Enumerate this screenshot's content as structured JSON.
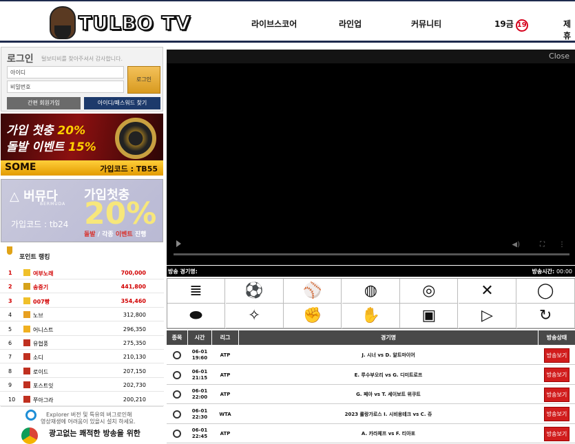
{
  "header": {
    "logo_text": "TULBO TV",
    "nav": [
      "라이브스코어",
      "라인업",
      "커뮤니티",
      "19금",
      "제휴"
    ],
    "nav_badge": "19"
  },
  "login": {
    "title": "로그인",
    "subtitle": "털보티비를 찾아주셔서 감사합니다.",
    "id_placeholder": "아이디",
    "pw_placeholder": "비밀번호",
    "login_button": "로그인",
    "signup_button": "간편 회원가입",
    "find_button": "아이디/패스워드 찾기"
  },
  "banner1": {
    "line1a": "가입 첫충",
    "line1b": "20%",
    "line2a": "돌발 이벤트",
    "line2b": "15%",
    "brand": "SOME",
    "code": "가입코드 : TB55"
  },
  "banner2": {
    "brand": "버뮤다",
    "brand_sub": "BERMUDA",
    "headline": "가입첫충",
    "percent": "20%",
    "code": "가입코드 : tb24",
    "event_a": "돌발",
    "event_b": "/ 각종",
    "event_c": "이벤트",
    "event_d": "진행"
  },
  "ranking": {
    "title": "포인트 랭킹",
    "rows": [
      {
        "rank": "1",
        "name": "여부노래",
        "points": "700,000",
        "top": true
      },
      {
        "rank": "2",
        "name": "송중기",
        "points": "441,800",
        "top": true
      },
      {
        "rank": "3",
        "name": "007빵",
        "points": "354,460",
        "top": true
      },
      {
        "rank": "4",
        "name": "노브",
        "points": "312,800",
        "top": false
      },
      {
        "rank": "5",
        "name": "어니스트",
        "points": "296,350",
        "top": false
      },
      {
        "rank": "6",
        "name": "유협풍",
        "points": "275,350",
        "top": false
      },
      {
        "rank": "7",
        "name": "소디",
        "points": "210,130",
        "top": false
      },
      {
        "rank": "8",
        "name": "로이드",
        "points": "207,150",
        "top": false
      },
      {
        "rank": "9",
        "name": "포스트잇",
        "points": "202,730",
        "top": false
      },
      {
        "rank": "10",
        "name": "쭈아그라",
        "points": "200,210",
        "top": false
      }
    ]
  },
  "explorer_notice": {
    "line1": "Explorer 버전 및 특유의 버그로인해",
    "line2": "영상재생에 어려움이 있을시 설치 하세요.",
    "line3": "광고없는 쾌적한 방송을 위한"
  },
  "player": {
    "close": "Close",
    "game_label": "방송 경기명:",
    "time_label": "방송시간:",
    "time_value": "00:00"
  },
  "sports_icons": [
    "list-icon",
    "soccer-icon",
    "baseball-icon",
    "basketball-icon",
    "volleyball-icon",
    "hockey-icon",
    "tennis-icon",
    "football-icon",
    "lol-icon",
    "fist-icon",
    "ufc-icon",
    "hd-icon",
    "play-icon",
    "refresh-icon"
  ],
  "schedule": {
    "headers": [
      "종목",
      "시간",
      "리그",
      "경기명",
      "방송상태"
    ],
    "watch_label": "방송보기",
    "rows": [
      {
        "date": "06-01",
        "time": "19:60",
        "league": "ATP",
        "match": "J. 시너 vs D. 알트마이어"
      },
      {
        "date": "06-01",
        "time": "21:15",
        "league": "ATP",
        "match": "E. 루수부오리 vs G. 디미트로프"
      },
      {
        "date": "06-01",
        "time": "22:00",
        "league": "ATP",
        "match": "G. 페아 vs T. 세이보트 위쿠트"
      },
      {
        "date": "06-01",
        "time": "22:30",
        "league": "WTA",
        "match": "2023 롤랑가로스 I. 시비옹테크 vs C. 쥬"
      },
      {
        "date": "06-01",
        "time": "22:45",
        "league": "ATP",
        "match": "A. 카라체프 vs F. 티아포"
      }
    ]
  }
}
